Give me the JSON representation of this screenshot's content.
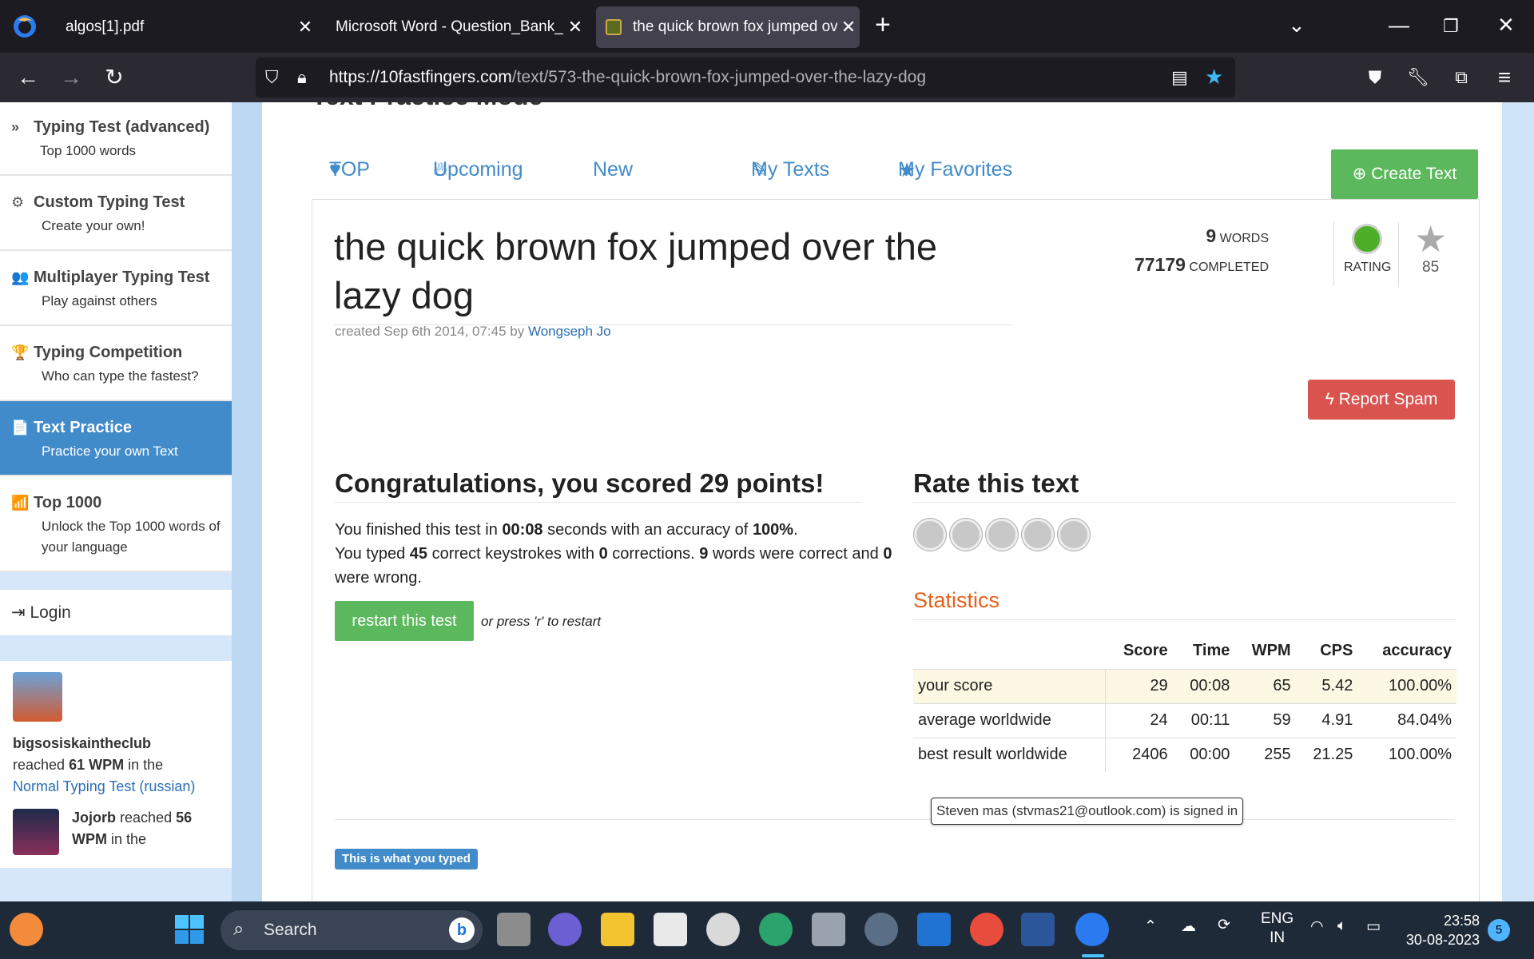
{
  "browser": {
    "tabs": [
      {
        "label": "algos[1].pdf",
        "close": "✕"
      },
      {
        "label": "Microsoft Word - Question_Bank_IA",
        "close": "✕"
      },
      {
        "label": "the quick brown fox jumped over the lazy dog",
        "close": "✕"
      }
    ],
    "new_tab": "+",
    "url_domain": "https://10fastfingers.com",
    "url_path": "/text/573-the-quick-brown-fox-jumped-over-the-lazy-dog",
    "icons": [
      "back-icon",
      "forward-icon",
      "reload-icon",
      "shield-icon",
      "lock-icon",
      "reader-icon",
      "bookmark-star-icon",
      "pocket-icon",
      "wrench-icon",
      "extensions-icon",
      "menu-icon"
    ]
  },
  "sidebar": {
    "items": [
      {
        "title": "Typing Test (advanced)",
        "sub": "Top 1000 words",
        "icon": "»"
      },
      {
        "title": "Custom Typing Test",
        "sub": "Create your own!",
        "icon": "⚙"
      },
      {
        "title": "Multiplayer Typing Test",
        "sub": "Play against others",
        "icon": "👥"
      },
      {
        "title": "Typing Competition",
        "sub": "Who can type the fastest?",
        "icon": "🏆"
      },
      {
        "title": "Text Practice",
        "sub": "Practice your own Text",
        "icon": "📄"
      },
      {
        "title": "Top 1000",
        "sub": "Unlock the Top 1000 words of your language",
        "icon": "📶"
      }
    ],
    "login": "Login",
    "feed": [
      {
        "user": "bigsosiskaintheclub",
        "pre": "reached",
        "wpm": "61 WPM",
        "mid": "in the",
        "link": "Normal Typing Test (russian)"
      },
      {
        "user": "Jojorb",
        "pre": "reached",
        "wpm": "56 WPM",
        "mid": "in the"
      }
    ]
  },
  "page": {
    "mode_title": "Text Practice Mode",
    "tabs": {
      "top": "TOP",
      "upcoming": "Upcoming",
      "new": "New",
      "my_texts": "My Texts",
      "favorites": "My Favorites"
    },
    "create_text": "Create Text",
    "text_title": "the quick brown fox jumped over the lazy dog",
    "created_prefix": "created Sep 6th 2014, 07:45 by",
    "author": "Wongseph Jo",
    "words_count": "9",
    "words_label": "WORDS",
    "completed_count": "77179",
    "completed_label": "COMPLETED",
    "rating_label": "RATING",
    "favorites_count": "85",
    "report_spam": "Report Spam",
    "congrats": "Congratulations, you scored 29 points!",
    "result": {
      "l1a": "You finished this test in",
      "time": "00:08",
      "l1b": "seconds with an accuracy of",
      "acc": "100%",
      "l1c": ".",
      "l2a": "You typed",
      "keys": "45",
      "l2b": "correct keystrokes with",
      "corr": "0",
      "l2c": "corrections.",
      "words": "9",
      "l2d": "words were correct and",
      "wrong": "0",
      "l2e": "were wrong."
    },
    "restart": "restart this test",
    "restart_hint": "or press 'r' to restart",
    "rate_heading": "Rate this text",
    "stats_heading": "Statistics",
    "stats": {
      "headers": [
        "",
        "Score",
        "Time",
        "WPM",
        "CPS",
        "accuracy"
      ],
      "rows": [
        [
          "your score",
          "29",
          "00:08",
          "65",
          "5.42",
          "100.00%"
        ],
        [
          "average worldwide",
          "24",
          "00:11",
          "59",
          "4.91",
          "84.04%"
        ],
        [
          "best result worldwide",
          "2406",
          "00:00",
          "255",
          "21.25",
          "100.00%"
        ]
      ]
    },
    "tooltip": "Steven mas (stvmas21@outlook.com) is signed in",
    "typed_label": "This is what you typed"
  },
  "taskbar": {
    "search": "Search",
    "lang": "ENG",
    "region": "IN",
    "time": "23:58",
    "date": "30-08-2023",
    "notifications": "5"
  },
  "colors": {
    "primary": "#428bca",
    "success": "#5cb85c",
    "danger": "#d9534f",
    "stats": "#e5601c"
  }
}
